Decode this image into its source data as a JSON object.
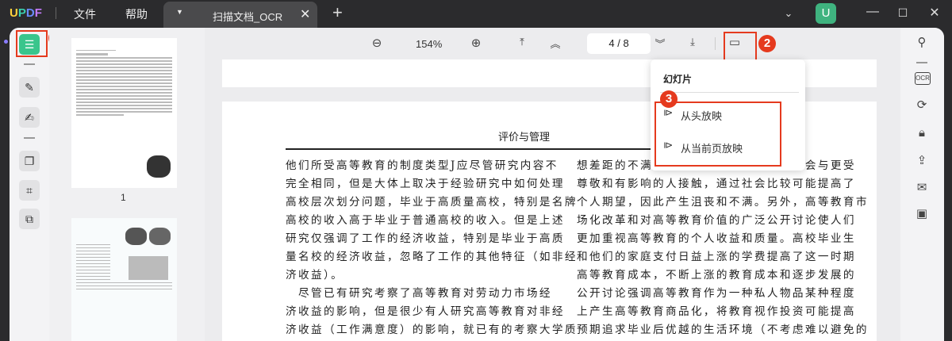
{
  "app": {
    "logo": "UPDF",
    "menu": [
      "文件",
      "帮助"
    ],
    "tab_title": "扫描文档_OCR",
    "avatar": "U"
  },
  "toolbar": {
    "zoom": "154%",
    "page_current": "4",
    "page_sep": "/",
    "page_total": "8"
  },
  "thumbnails": [
    {
      "label": "1"
    }
  ],
  "slideshow_menu": {
    "title": "幻灯片",
    "items": [
      "从头放映",
      "从当前页放映"
    ]
  },
  "badges": [
    "1",
    "2",
    "3"
  ],
  "document": {
    "header": "评价与管理",
    "left_column": [
      "他们所受高等教育的制度类型J应尽管研究内容不",
      "完全相同，但是大体上取决于经验研究中如何处理",
      "高校层次划分问题，毕业于高质量高校，特别是名牌",
      "高校的收入高于毕业于普通高校的收入。但是上述",
      "研究仅强调了工作的经济收益，特别是毕业于高质",
      "量名校的经济收益，忽略了工作的其他特征（如非经",
      "济收益）。",
      "　尽管已有研究考察了高等教育对劳动力市场经",
      "济收益的影响，但是很少有人研究高等教育对非经",
      "济收益（工作满意度）的影响，就已有的考察大学质"
    ],
    "right_column": [
      "想差距的不满。因为接受高质量大学教育会与更受",
      "尊敬和有影响的人接触，通过社会比较可能提高了",
      "个人期望，因此产生沮丧和不满。另外，高等教育市",
      "场化改革和对高等教育价值的广泛公开讨论使人们",
      "更加重视高等教育的个人收益和质量。高校毕业生",
      "和他们的家庭支付日益上涨的学费提高了这一时期",
      "高等教育成本，不断上涨的教育成本和逐步发展的",
      "公开讨论强调高等教育作为一种私人物品某种程度",
      "上产生高等教育商品化，将教育视作投资可能提高",
      "预期追求毕业后优越的生活环境（不考虑难以避免的"
    ]
  },
  "colors": {
    "accent": "#3ac58c",
    "annotation": "#e53a1e",
    "titlebar": "#2b2b2d"
  }
}
